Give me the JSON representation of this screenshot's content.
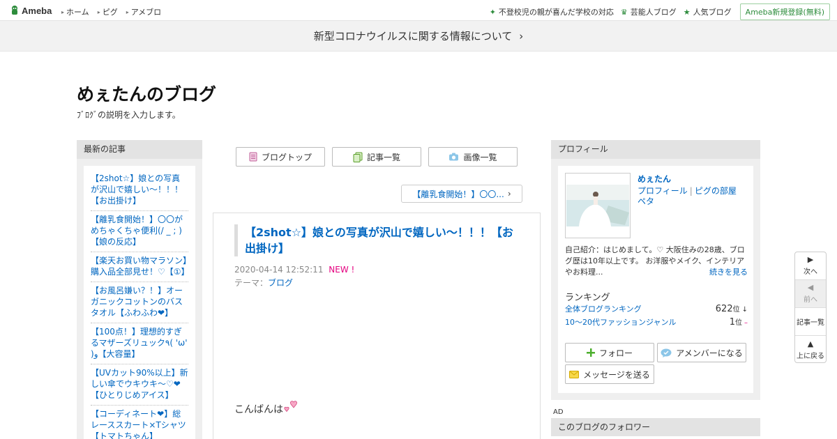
{
  "topbar": {
    "logo": "Ameba",
    "nav": [
      "ホーム",
      "ピグ",
      "アメブロ"
    ],
    "right_links": [
      "不登校児の親が喜んだ学校の対応",
      "芸能人ブログ",
      "人気ブログ"
    ],
    "register": "Ameba新規登録(無料)"
  },
  "corona": {
    "text": "新型コロナウイルスに関する情報について",
    "chevron": "›"
  },
  "blog": {
    "title": "めぇたんのブログ",
    "description": "ﾌﾞﾛｸﾞの説明を入力します。"
  },
  "recent": {
    "heading": "最新の記事",
    "items": [
      "【2shot☆】娘との写真が沢山で嬉しい〜！！！【お出掛け】",
      "【離乳食開始！】〇〇がめちゃくちゃ便利(/ _ ; )【娘の反応】",
      "【楽天お買い物マラソン】購入品全部見せ！♡【①】",
      "【お風呂嫌い？！】オーガニックコットンのバスタオル【ふわふわ❤︎】",
      "【100点！】理想的すぎるマザーズリュック٩( 'ω' )و【大容量】",
      "【UVカット90%以上】新しい傘でウキウキ〜♡❤︎【ひとりじめアイス】",
      "【コーディネート❤︎】総レーススカート×Tシャツ【トマトちゃん】"
    ]
  },
  "center_nav": {
    "blog_top": "ブログトップ",
    "entry_list": "記事一覧",
    "image_list": "画像一覧"
  },
  "prev_post": {
    "label": "【離乳食開始！】〇〇...",
    "chevron": "›"
  },
  "article": {
    "title": "【2shot☆】娘との写真が沢山で嬉しい〜！！！【お出掛け】",
    "datetime": "2020-04-14 12:52:11",
    "new_badge": "NEW !",
    "theme_label": "テーマ：",
    "theme": "ブログ",
    "body_start": "こんばんは"
  },
  "profile": {
    "heading": "プロフィール",
    "name": "めぇたん",
    "link_profile": "プロフィール",
    "link_room": "ピグの部屋",
    "link_pet": "ペタ",
    "intro": "自己紹介：はじめまして。♡ 大阪住みの28歳、ブログ歴は10年以上です。 お洋服やメイク、インテリアやお料理...",
    "more": "続きを見る",
    "ranking_title": "ランキング",
    "rankings": [
      {
        "label": "全体ブログランキング",
        "value": "622",
        "unit": "位",
        "trend": "↓"
      },
      {
        "label": "10〜20代ファッションジャンル",
        "value": "1",
        "unit": "位",
        "trend": "–"
      }
    ],
    "follow": "フォロー",
    "amember": "アメンバーになる",
    "message": "メッセージを送る"
  },
  "ad_label": "AD",
  "followers_heading": "このブログのフォロワー",
  "sidenav": {
    "next": "次へ",
    "prev": "前へ",
    "list": "記事一覧",
    "top": "上に戻る"
  },
  "colors": {
    "link": "#0066c0",
    "ameba_green": "#2d8c3c",
    "new_pink": "#e4007f",
    "panel_gray": "#efefef"
  }
}
